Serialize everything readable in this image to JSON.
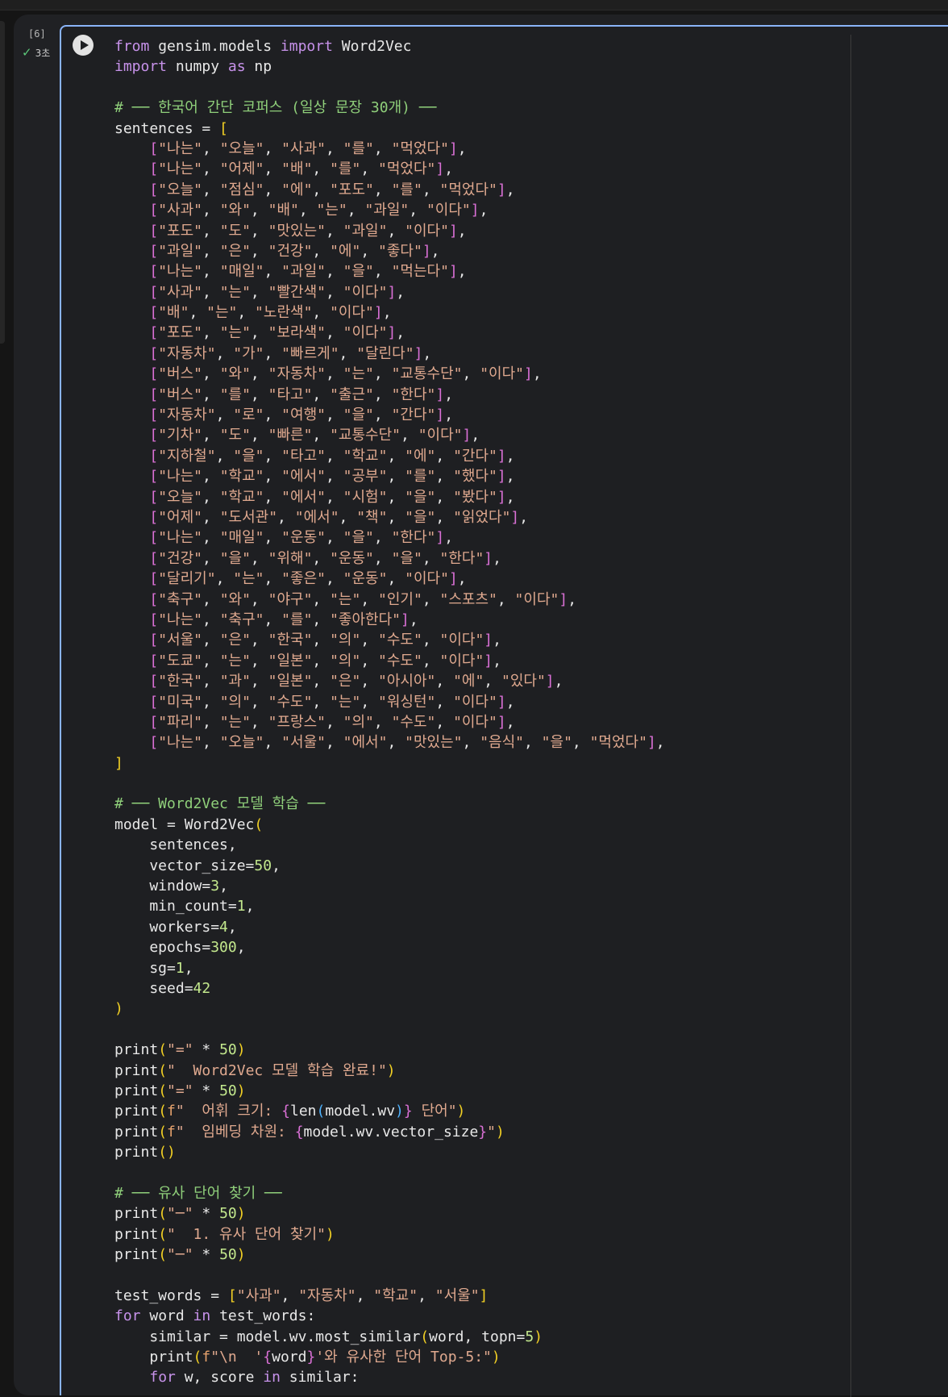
{
  "cell": {
    "execution_count": "[6]",
    "status_time": "3초",
    "status_icon": "check-icon"
  },
  "code_lines": [
    "from gensim.models import Word2Vec",
    "import numpy as np",
    "",
    "# ── 한국어 간단 코퍼스 (일상 문장 30개) ──",
    "sentences = [",
    "    [\"나는\", \"오늘\", \"사과\", \"를\", \"먹었다\"],",
    "    [\"나는\", \"어제\", \"배\", \"를\", \"먹었다\"],",
    "    [\"오늘\", \"점심\", \"에\", \"포도\", \"를\", \"먹었다\"],",
    "    [\"사과\", \"와\", \"배\", \"는\", \"과일\", \"이다\"],",
    "    [\"포도\", \"도\", \"맛있는\", \"과일\", \"이다\"],",
    "    [\"과일\", \"은\", \"건강\", \"에\", \"좋다\"],",
    "    [\"나는\", \"매일\", \"과일\", \"을\", \"먹는다\"],",
    "    [\"사과\", \"는\", \"빨간색\", \"이다\"],",
    "    [\"배\", \"는\", \"노란색\", \"이다\"],",
    "    [\"포도\", \"는\", \"보라색\", \"이다\"],",
    "    [\"자동차\", \"가\", \"빠르게\", \"달린다\"],",
    "    [\"버스\", \"와\", \"자동차\", \"는\", \"교통수단\", \"이다\"],",
    "    [\"버스\", \"를\", \"타고\", \"출근\", \"한다\"],",
    "    [\"자동차\", \"로\", \"여행\", \"을\", \"간다\"],",
    "    [\"기차\", \"도\", \"빠른\", \"교통수단\", \"이다\"],",
    "    [\"지하철\", \"을\", \"타고\", \"학교\", \"에\", \"간다\"],",
    "    [\"나는\", \"학교\", \"에서\", \"공부\", \"를\", \"했다\"],",
    "    [\"오늘\", \"학교\", \"에서\", \"시험\", \"을\", \"봤다\"],",
    "    [\"어제\", \"도서관\", \"에서\", \"책\", \"을\", \"읽었다\"],",
    "    [\"나는\", \"매일\", \"운동\", \"을\", \"한다\"],",
    "    [\"건강\", \"을\", \"위해\", \"운동\", \"을\", \"한다\"],",
    "    [\"달리기\", \"는\", \"좋은\", \"운동\", \"이다\"],",
    "    [\"축구\", \"와\", \"야구\", \"는\", \"인기\", \"스포츠\", \"이다\"],",
    "    [\"나는\", \"축구\", \"를\", \"좋아한다\"],",
    "    [\"서울\", \"은\", \"한국\", \"의\", \"수도\", \"이다\"],",
    "    [\"도쿄\", \"는\", \"일본\", \"의\", \"수도\", \"이다\"],",
    "    [\"한국\", \"과\", \"일본\", \"은\", \"아시아\", \"에\", \"있다\"],",
    "    [\"미국\", \"의\", \"수도\", \"는\", \"워싱턴\", \"이다\"],",
    "    [\"파리\", \"는\", \"프랑스\", \"의\", \"수도\", \"이다\"],",
    "    [\"나는\", \"오늘\", \"서울\", \"에서\", \"맛있는\", \"음식\", \"을\", \"먹었다\"],",
    "]",
    "",
    "# ── Word2Vec 모델 학습 ──",
    "model = Word2Vec(",
    "    sentences,",
    "    vector_size=50,",
    "    window=3,",
    "    min_count=1,",
    "    workers=4,",
    "    epochs=300,",
    "    sg=1,",
    "    seed=42",
    ")",
    "",
    "print(\"=\" * 50)",
    "print(\"  Word2Vec 모델 학습 완료!\")",
    "print(\"=\" * 50)",
    "print(f\"  어휘 크기: {len(model.wv)} 단어\")",
    "print(f\"  임베딩 차원: {model.wv.vector_size}\")",
    "print()",
    "",
    "# ── 유사 단어 찾기 ──",
    "print(\"─\" * 50)",
    "print(\"  1. 유사 단어 찾기\")",
    "print(\"─\" * 50)",
    "",
    "test_words = [\"사과\", \"자동차\", \"학교\", \"서울\"]",
    "for word in test_words:",
    "    similar = model.wv.most_similar(word, topn=5)",
    "    print(f\"\\n  '{word}'와 유사한 단어 Top-5:\")",
    "    for w, score in similar:"
  ],
  "colors": {
    "keyword": "#c792ea",
    "string": "#e0a98f",
    "number": "#c3e88d",
    "comment": "#8fcf7a",
    "bracket_level_1": "#f2d024",
    "bracket_level_2": "#da70d6",
    "bracket_level_3": "#4fb3ff",
    "editor_border": "#8ab4f8"
  }
}
